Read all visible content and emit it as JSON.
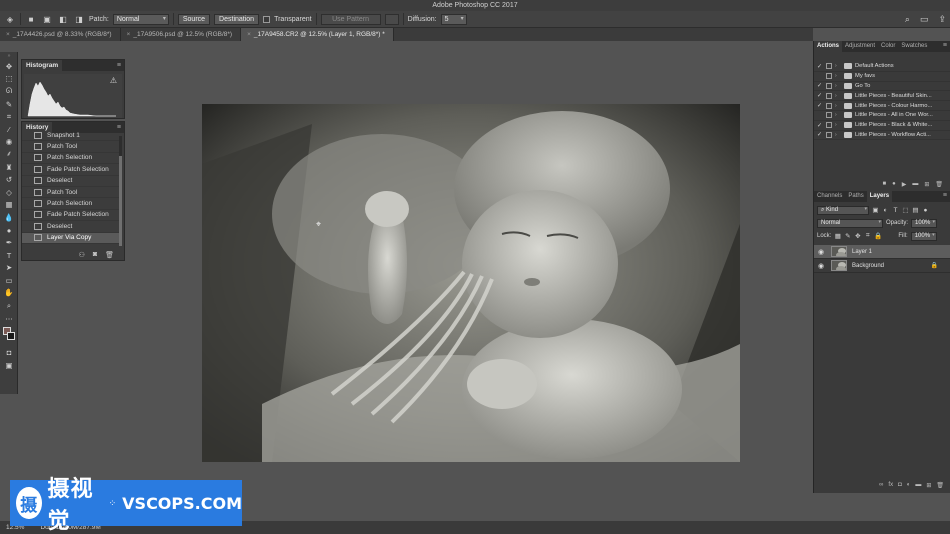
{
  "app": {
    "title": "Adobe Photoshop CC 2017"
  },
  "options_bar": {
    "patch_label": "Patch:",
    "patch_mode": "Normal",
    "source_btn": "Source",
    "destination_btn": "Destination",
    "transparent_label": "Transparent",
    "use_pattern_btn": "Use Pattern",
    "diffusion_label": "Diffusion:",
    "diffusion_value": "5"
  },
  "tabs": [
    {
      "label": "_17A4426.psd @ 8.33% (RGB/8*)",
      "active": false
    },
    {
      "label": "_17A9506.psd @ 12.5% (RGB/8*)",
      "active": false
    },
    {
      "label": "_17A9458.CR2 @ 12.5% (Layer 1, RGB/8*) *",
      "active": true
    }
  ],
  "histogram": {
    "tab": "Histogram"
  },
  "history": {
    "tab": "History",
    "items": [
      {
        "label": "Snapshot 1",
        "active": false
      },
      {
        "label": "Patch Tool",
        "active": false
      },
      {
        "label": "Patch Selection",
        "active": false
      },
      {
        "label": "Fade Patch Selection",
        "active": false
      },
      {
        "label": "Deselect",
        "active": false
      },
      {
        "label": "Patch Tool",
        "active": false
      },
      {
        "label": "Patch Selection",
        "active": false
      },
      {
        "label": "Fade Patch Selection",
        "active": false
      },
      {
        "label": "Deselect",
        "active": false
      },
      {
        "label": "Layer Via Copy",
        "active": true
      }
    ]
  },
  "actions_panel": {
    "tabs": [
      "Actions",
      "Adjustment",
      "Color",
      "Swatches"
    ],
    "rows": [
      {
        "label": "Default Actions",
        "check": "✓",
        "red": false
      },
      {
        "label": "My favs",
        "check": "",
        "red": true
      },
      {
        "label": "Go To",
        "check": "✓",
        "red": false
      },
      {
        "label": "Little Pieces - Beautiful Skin...",
        "check": "✓",
        "red": false
      },
      {
        "label": "Little Pieces - Colour Harmo...",
        "check": "✓",
        "red": false
      },
      {
        "label": "Little Pieces - All in One Wor...",
        "check": "",
        "red": false
      },
      {
        "label": "Little Pieces - Black & White...",
        "check": "✓",
        "red": false
      },
      {
        "label": "Little Pieces - Workflow Acti...",
        "check": "✓",
        "red": false
      }
    ]
  },
  "layers_panel": {
    "tabs": [
      "Channels",
      "Paths",
      "Layers"
    ],
    "filter": "Kind",
    "blend_mode": "Normal",
    "opacity_label": "Opacity:",
    "opacity_value": "100%",
    "lock_label": "Lock:",
    "fill_label": "Fill:",
    "fill_value": "100%",
    "layers": [
      {
        "name": "Layer 1",
        "selected": true,
        "locked": false
      },
      {
        "name": "Background",
        "selected": false,
        "locked": true
      }
    ]
  },
  "status": {
    "zoom": "12.5%",
    "doc": "Doc: 144.0M/287.9M"
  },
  "watermark": {
    "icon": "摄",
    "chinese": "摄视觉",
    "english": "VSCOPS.COM"
  }
}
